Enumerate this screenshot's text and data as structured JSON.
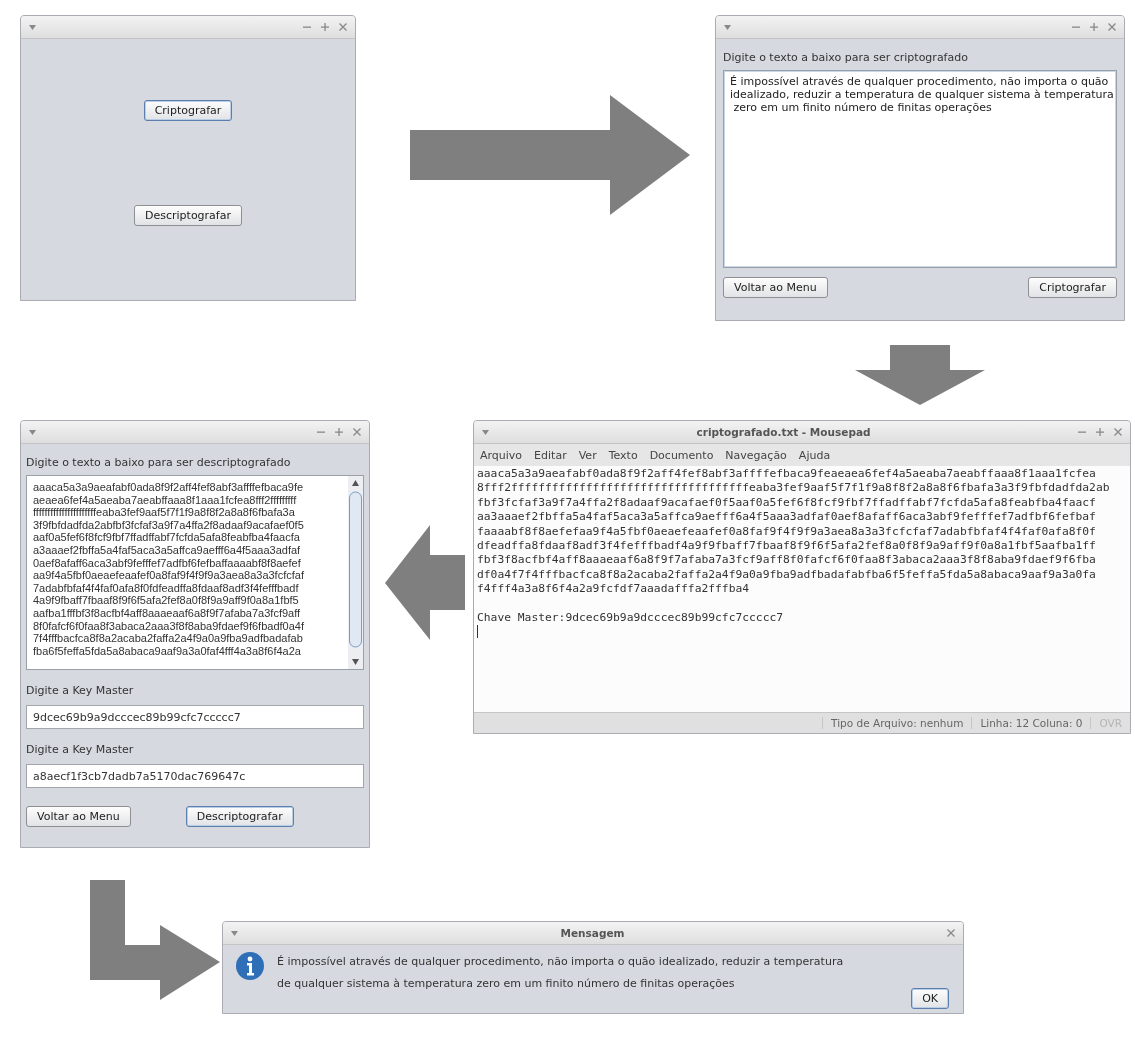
{
  "menu_window": {
    "buttons": [
      {
        "label": "Criptografar",
        "focused": true
      },
      {
        "label": "Descriptografar",
        "focused": false
      }
    ]
  },
  "encrypt_window": {
    "label": "Digite o texto a baixo para ser criptografado",
    "text_lines": [
      "É impossível através de qualquer procedimento, não importa o quão",
      "idealizado, reduzir a temperatura de qualquer sistema à temperatura",
      " zero em um finito número de finitas operações"
    ],
    "buttons": [
      {
        "label": "Voltar ao Menu",
        "focused": false
      },
      {
        "label": "Criptografar",
        "focused": false
      }
    ]
  },
  "editor_window": {
    "title": "criptografado.txt - Mousepad",
    "menu": [
      "Arquivo",
      "Editar",
      "Ver",
      "Texto",
      "Documento",
      "Navegação",
      "Ajuda"
    ],
    "lines": [
      "aaaca5a3a9aeafabf0ada8f9f2aff4fef8abf3affffefbaca9feaeaea6fef4a5aeaba7aeabffaaa8f1aaa1fcfea",
      "8fff2fffffffffffffffffffffffffffffffffffeaba3fef9aaf5f7f1f9a8f8f2a8a8f6fbafa3a3f9fbfdadfda2ab",
      "fbf3fcfaf3a9f7a4ffa2f8adaaf9acafaef0f5aaf0a5fef6f8fcf9fbf7ffadffabf7fcfda5afa8feabfba4faacf",
      "aa3aaaef2fbffa5a4faf5aca3a5affca9aefff6a4f5aaa3adfaf0aef8afaff6aca3abf9fefffef7adfbf6fefbaf",
      "faaaabf8f8aefefaa9f4a5fbf0aeaefeaafef0a8faf9f4f9f9a3aea8a3a3fcfcfaf7adabfbfaf4f4faf0afa8f0f",
      "dfeadffa8fdaaf8adf3f4fefffbadf4a9f9fbaff7fbaaf8f9f6f5afa2fef8a0f8f9a9aff9f0a8a1fbf5aafba1ff",
      "fbf3f8acfbf4aff8aaaeaaf6a8f9f7afaba7a3fcf9aff8f0fafcf6f0faa8f3abaca2aaa3f8f8aba9fdaef9f6fba",
      "df0a4f7f4fffbacfca8f8a2acaba2faffa2a4f9a0a9fba9adfbadafabfba6f5feffa5fda5a8abaca9aaf9a3a0fa",
      "f4fff4a3a8f6f4a2a9fcfdf7aaadafffa2fffba4",
      "Chave Master:9dcec69b9a9dcccec89b99cfc7ccccc7"
    ],
    "status_bar": [
      {
        "text": "Tipo de Arquivo: nenhum",
        "disabled": false
      },
      {
        "text": "Linha: 12 Coluna: 0",
        "disabled": false
      },
      {
        "text": "OVR",
        "disabled": true
      }
    ]
  },
  "decrypt_window": {
    "label": "Digite o texto a baixo para ser descriptografado",
    "text_lines": [
      "aaaca5a3a9aeafabf0ada8f9f2aff4fef8abf3affffefbaca9fe",
      "aeaea6fef4a5aeaba7aeabffaaa8f1aaa1fcfea8fff2fffffffff",
      "ffffffffffffffffffffffeaba3fef9aaf5f7f1f9a8f8f2a8a8f6fbafa3a",
      "3f9fbfdadfda2abfbf3fcfaf3a9f7a4ffa2f8adaaf9acafaef0f5",
      "aaf0a5fef6f8fcf9fbf7ffadffabf7fcfda5afa8feabfba4faacfa",
      "a3aaaef2fbffa5a4faf5aca3a5affca9aefff6a4f5aaa3adfaf",
      "0aef8afaff6aca3abf9fefffef7adfbf6fefbaffaaaabf8f8aefef",
      "aa9f4a5fbf0aeaefeaafef0a8faf9f4f9f9a3aea8a3a3fcfcfaf",
      "7adabfbfaf4f4faf0afa8f0fdfeadffa8fdaaf8adf3f4fefffbadf",
      "4a9f9fbaff7fbaaf8f9f6f5afa2fef8a0f8f9a9aff9f0a8a1fbf5",
      "aafba1fffbf3f8acfbf4aff8aaaeaaf6a8f9f7afaba7a3fcf9aff",
      "8f0fafcf6f0faa8f3abaca2aaa3f8f8aba9fdaef9f6fbadf0a4f",
      "7f4fffbacfca8f8a2acaba2faffa2a4f9a0a9fba9adfbadafab",
      "fba6f5feffa5fda5a8abaca9aaf9a3a0faf4fff4a3a8f6f4a2a"
    ],
    "fields": [
      {
        "label": "Digite a Key Master",
        "value": "9dcec69b9a9dcccec89b99cfc7ccccc7"
      },
      {
        "label": "Digite a Key Master",
        "value": "a8aecf1f3cb7dadb7a5170dac769647c"
      }
    ],
    "buttons": [
      {
        "label": "Voltar ao Menu",
        "focused": false
      },
      {
        "label": "Descriptografar",
        "focused": true
      }
    ]
  },
  "message_dialog": {
    "title": "Mensagem",
    "lines": [
      "É impossível através de qualquer procedimento, não importa o quão idealizado, reduzir a temperatura",
      "de qualquer sistema à temperatura zero em um finito número de finitas operações"
    ],
    "button": {
      "label": "OK",
      "focused": true
    }
  }
}
